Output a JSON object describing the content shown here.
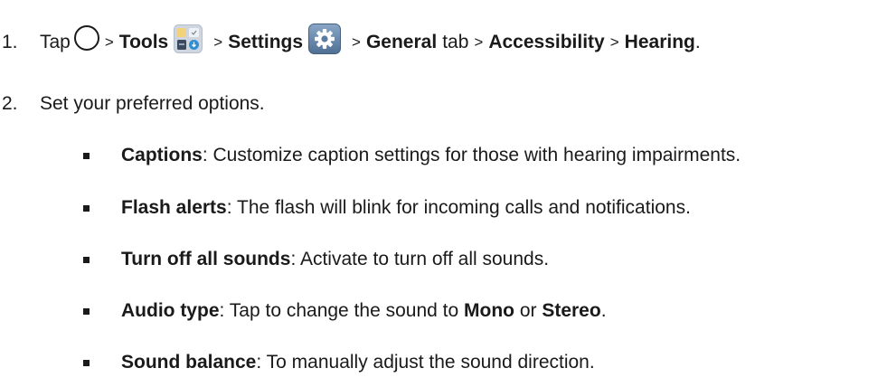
{
  "steps": [
    {
      "number": "1.",
      "tap": "Tap",
      "sep": ">",
      "tools": "Tools",
      "settings": "Settings",
      "general": "General",
      "tab": "tab",
      "accessibility": "Accessibility",
      "hearing": "Hearing",
      "end": ".",
      "icons": [
        "home-circle-icon",
        "tools-folder-icon",
        "settings-gear-icon"
      ]
    },
    {
      "number": "2.",
      "text": "Set your preferred options."
    }
  ],
  "options": [
    {
      "term": "Captions",
      "desc": ": Customize caption settings for those with hearing impairments."
    },
    {
      "term": "Flash alerts",
      "desc": ": The flash will blink for incoming calls and notifications."
    },
    {
      "term": "Turn off all sounds",
      "desc": ": Activate to turn off all sounds."
    },
    {
      "term": "Audio type",
      "desc": ": Tap to change the sound to ",
      "opt1": "Mono",
      "mid": " or ",
      "opt2": "Stereo",
      "end": "."
    },
    {
      "term": "Sound balance",
      "desc": ": To manually adjust the sound direction."
    }
  ],
  "colors": {
    "text": "#1a1a1a",
    "tools_icon_bg": "#cfd6e0",
    "tools_icon_accent": "#2e8fd6",
    "settings_icon_bg": "#6b8fb3"
  }
}
